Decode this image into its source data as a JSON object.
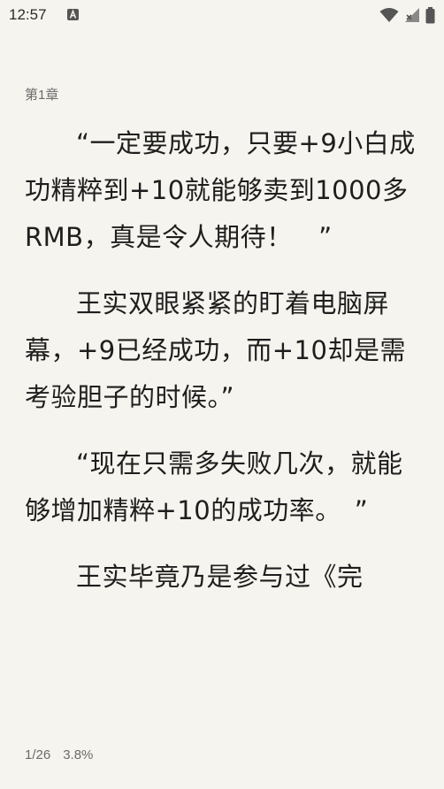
{
  "status_bar": {
    "time": "12:57",
    "icons": [
      "a-notification-icon",
      "wifi-icon",
      "signal-icon",
      "battery-icon"
    ]
  },
  "reader": {
    "chapter_title": "第1章",
    "paragraphs": [
      "“一定要成功，只要+9小白成功精粹到+10就能够卖到1000多RMB，真是令人期待！　”",
      "王实双眼紧紧的盯着电脑屏幕，+9已经成功，而+10却是需考验胆子的时候。”",
      "“现在只需多失败几次，就能够增加精粹+10的成功率。　”",
      "王实毕竟乃是参与过《完"
    ],
    "page_indicator": "1/26",
    "progress_percent": "3.8%"
  }
}
